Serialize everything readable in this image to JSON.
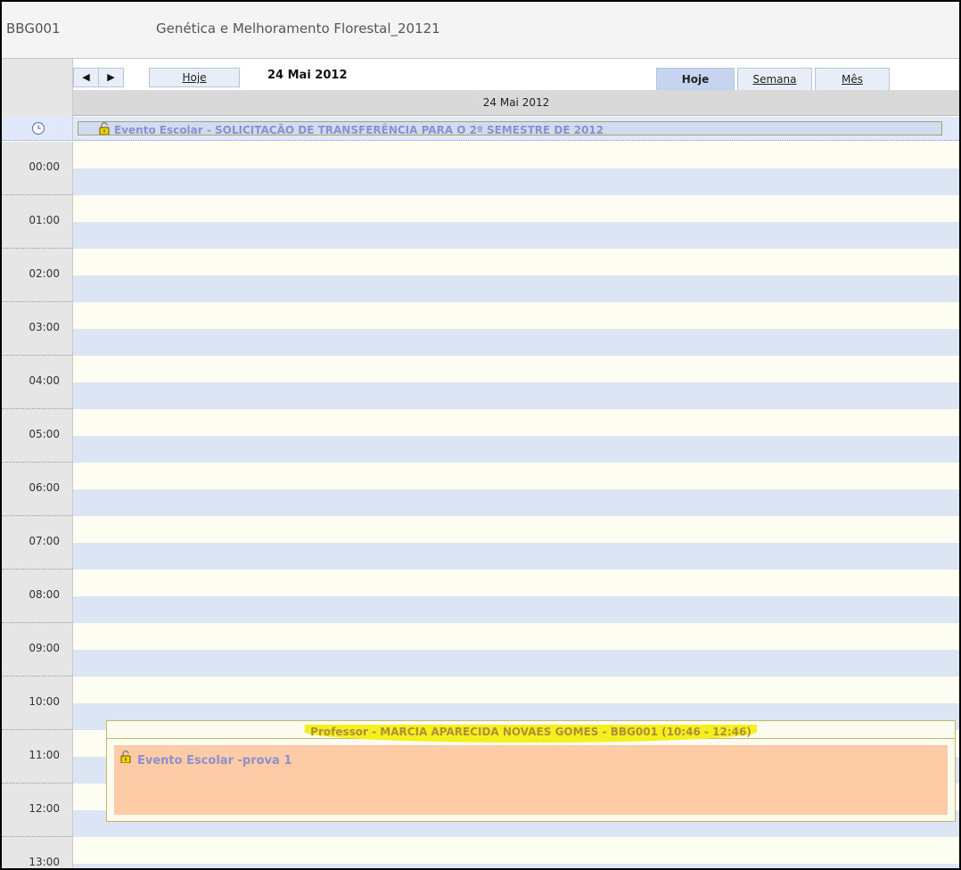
{
  "course": {
    "code": "BBG001",
    "title": "Genética e Melhoramento Florestal_20121"
  },
  "nav": {
    "prev_label": "◀",
    "next_label": "▶",
    "today_label": "Hoje",
    "current_date": "24 Mai 2012"
  },
  "views": [
    {
      "label": "Hoje",
      "active": true
    },
    {
      "label": "Semana",
      "active": false
    },
    {
      "label": "Mês",
      "active": false
    }
  ],
  "day_header": "24 Mai 2012",
  "all_day_event": {
    "label": "Evento Escolar - SOLICITAÇÃO DE TRANSFERÊNCIA PARA O 2º SEMESTRE DE 2012"
  },
  "hours": [
    "00:00",
    "01:00",
    "02:00",
    "03:00",
    "04:00",
    "05:00",
    "06:00",
    "07:00",
    "08:00",
    "09:00",
    "10:00",
    "11:00",
    "12:00",
    "13:00"
  ],
  "event": {
    "header": "Professor - MARCIA APARECIDA NOVAES GOMES - BBG001 (10:46 - 12:46)",
    "title": "Evento Escolar -prova 1"
  },
  "colors": {
    "grid_light": "#fdfdf2",
    "grid_blue": "#dce5f3",
    "event_body": "#fdcba6",
    "highlight": "#f4f01d",
    "event_text": "#8f8fce",
    "tab_active": "#c5d5ef"
  },
  "icons": {
    "clock": "clock-icon",
    "lock": "lock-icon"
  }
}
